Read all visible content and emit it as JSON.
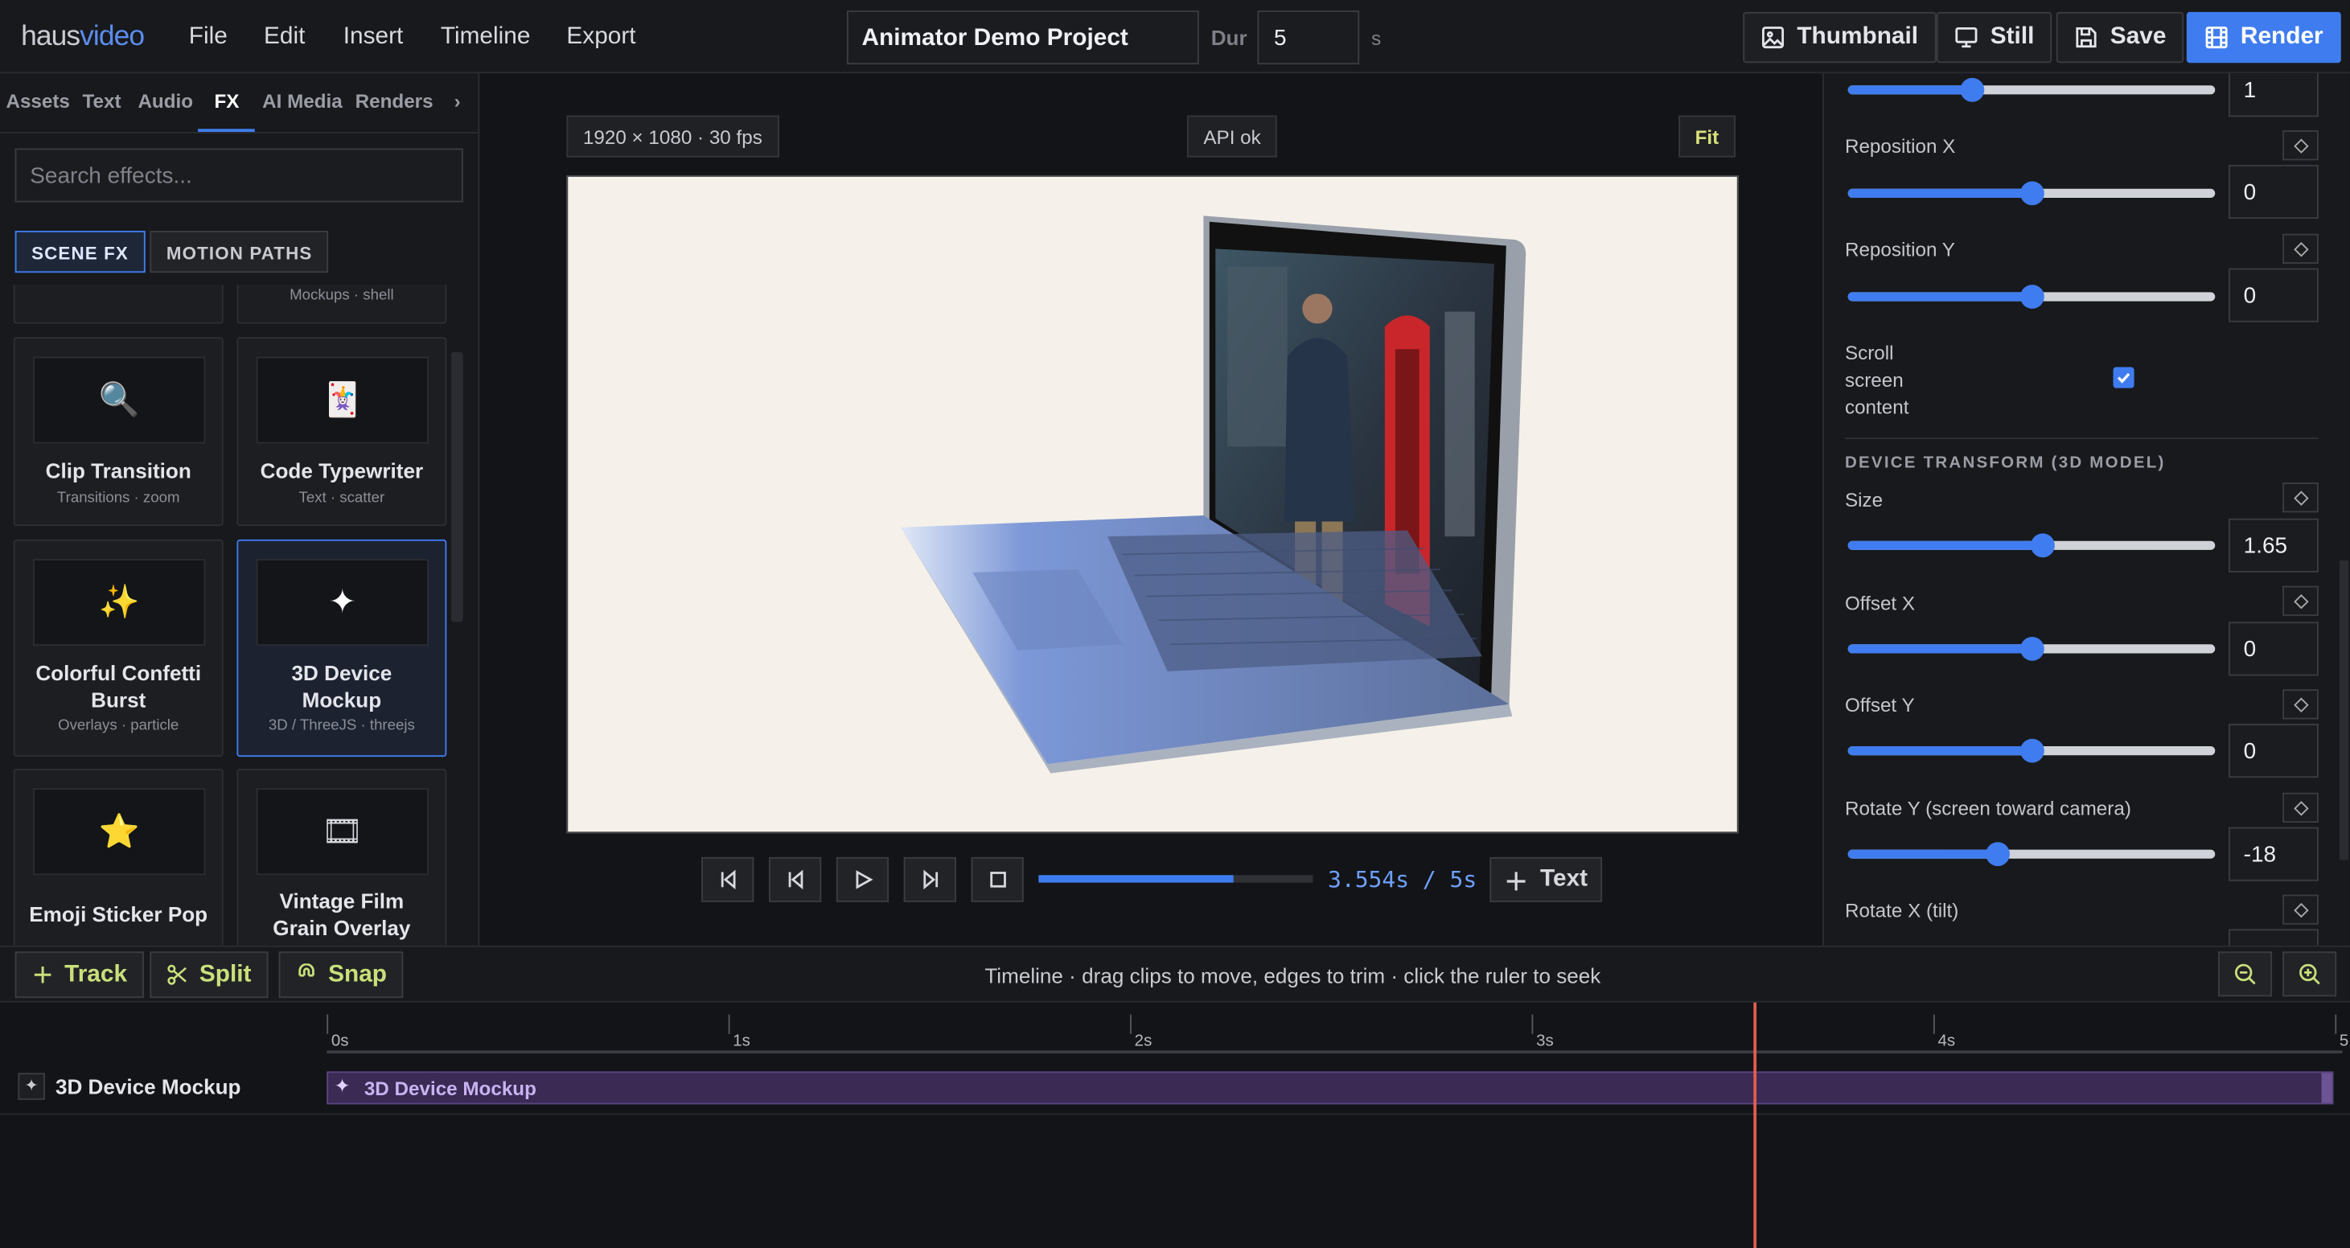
{
  "topbar": {
    "logo_a": "haus",
    "logo_b": "video",
    "menu": [
      "File",
      "Edit",
      "Insert",
      "Timeline",
      "Export"
    ],
    "project_name": "Animator Demo Project",
    "dur_label": "Dur",
    "dur_value": "5",
    "dur_unit": "s",
    "buttons": {
      "thumbnail": "Thumbnail",
      "still": "Still",
      "save": "Save",
      "render": "Render"
    }
  },
  "left": {
    "tabs": [
      "Assets",
      "Text",
      "Audio",
      "FX",
      "AI Media",
      "Renders",
      "›"
    ],
    "active_tab": "FX",
    "search_placeholder": "Search effects...",
    "segments": [
      "SCENE FX",
      "MOTION PATHS"
    ],
    "partial_card_sub": "Mockups · shell",
    "cards": [
      {
        "title": "Clip Transition",
        "sub": "Transitions · zoom",
        "icon": "magnifier-icon"
      },
      {
        "title": "Code Typewriter",
        "sub": "Text · scatter",
        "icon": "card-icon"
      },
      {
        "title": "Colorful Confetti Burst",
        "sub": "Overlays · particle",
        "icon": "sparkles-icon"
      },
      {
        "title": "3D Device Mockup",
        "sub": "3D / ThreeJS · threejs",
        "icon": "star4-icon"
      },
      {
        "title": "Emoji Sticker Pop",
        "sub": "",
        "icon": "star-icon"
      },
      {
        "title": "Vintage Film Grain Overlay",
        "sub": "",
        "icon": "film-icon"
      }
    ]
  },
  "center": {
    "resolution": "1920 × 1080 · 30 fps",
    "api_status": "API ok",
    "fit": "Fit",
    "time": "3.554s / 5s",
    "progress": 0.71,
    "text_button": "Text"
  },
  "right": {
    "top_value": "1",
    "top_level": 0.34,
    "props": [
      {
        "label": "Reposition X",
        "value": "0",
        "level": 0.5
      },
      {
        "label": "Reposition Y",
        "value": "0",
        "level": 0.5
      }
    ],
    "scroll_label_1": "Scroll",
    "scroll_label_2": "screen",
    "scroll_label_3": "content",
    "scroll_checked": true,
    "section": "DEVICE TRANSFORM (3D MODEL)",
    "props2": [
      {
        "label": "Size",
        "value": "1.65",
        "level": 0.53
      },
      {
        "label": "Offset X",
        "value": "0",
        "level": 0.5
      },
      {
        "label": "Offset Y",
        "value": "0",
        "level": 0.5
      },
      {
        "label": "Rotate Y (screen toward camera)",
        "value": "-18",
        "level": 0.41
      },
      {
        "label": "Rotate X (tilt)",
        "value": "",
        "level": 0.5
      }
    ]
  },
  "timeline": {
    "buttons": {
      "track": "Track",
      "split": "Split",
      "snap": "Snap"
    },
    "hint": "Timeline · drag clips to move, edges to trim · click the ruler to seek",
    "ticks": [
      "0s",
      "1s",
      "2s",
      "3s",
      "4s",
      "5"
    ],
    "track_name": "3D Device Mockup",
    "clip_label": "3D Device Mockup",
    "playhead": 3.554
  },
  "colors": {
    "accent": "#3f7cf0",
    "accent_green": "#c9e07a",
    "playhead": "#e35d4f",
    "clip": "#3a2a54"
  }
}
